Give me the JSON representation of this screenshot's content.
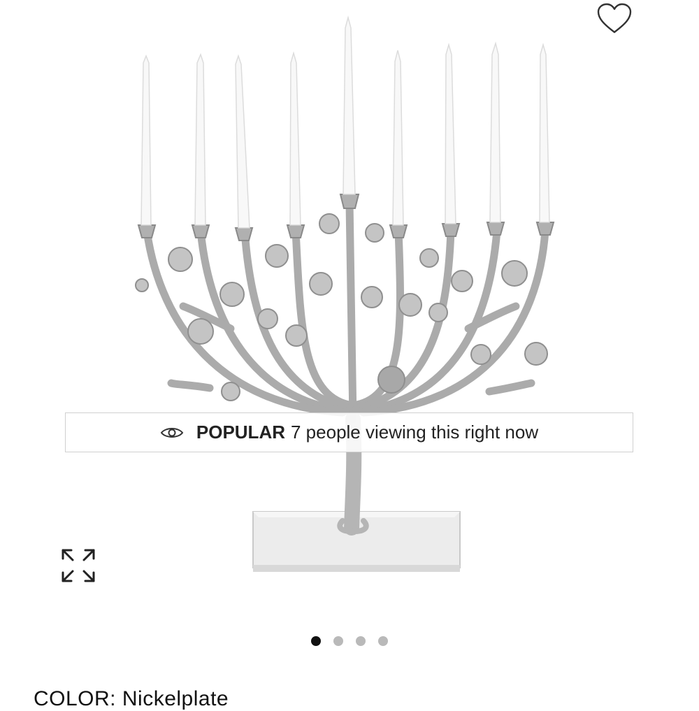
{
  "product": {
    "image_alt": "Menorah tree candelabra with nine white candles on a white marble base",
    "icons": {
      "favorite": "heart-outline-icon",
      "expand": "expand-arrows-icon",
      "viewing": "eye-icon"
    }
  },
  "badge": {
    "tag": "POPULAR",
    "text": "7 people viewing this right now"
  },
  "carousel": {
    "total": 4,
    "active_index": 0
  },
  "color": {
    "label": "COLOR:",
    "value": "Nickelplate"
  },
  "colors": {
    "dot_active": "#111111",
    "dot_inactive": "#b9b9b9",
    "badge_border": "#d0d0d0"
  }
}
